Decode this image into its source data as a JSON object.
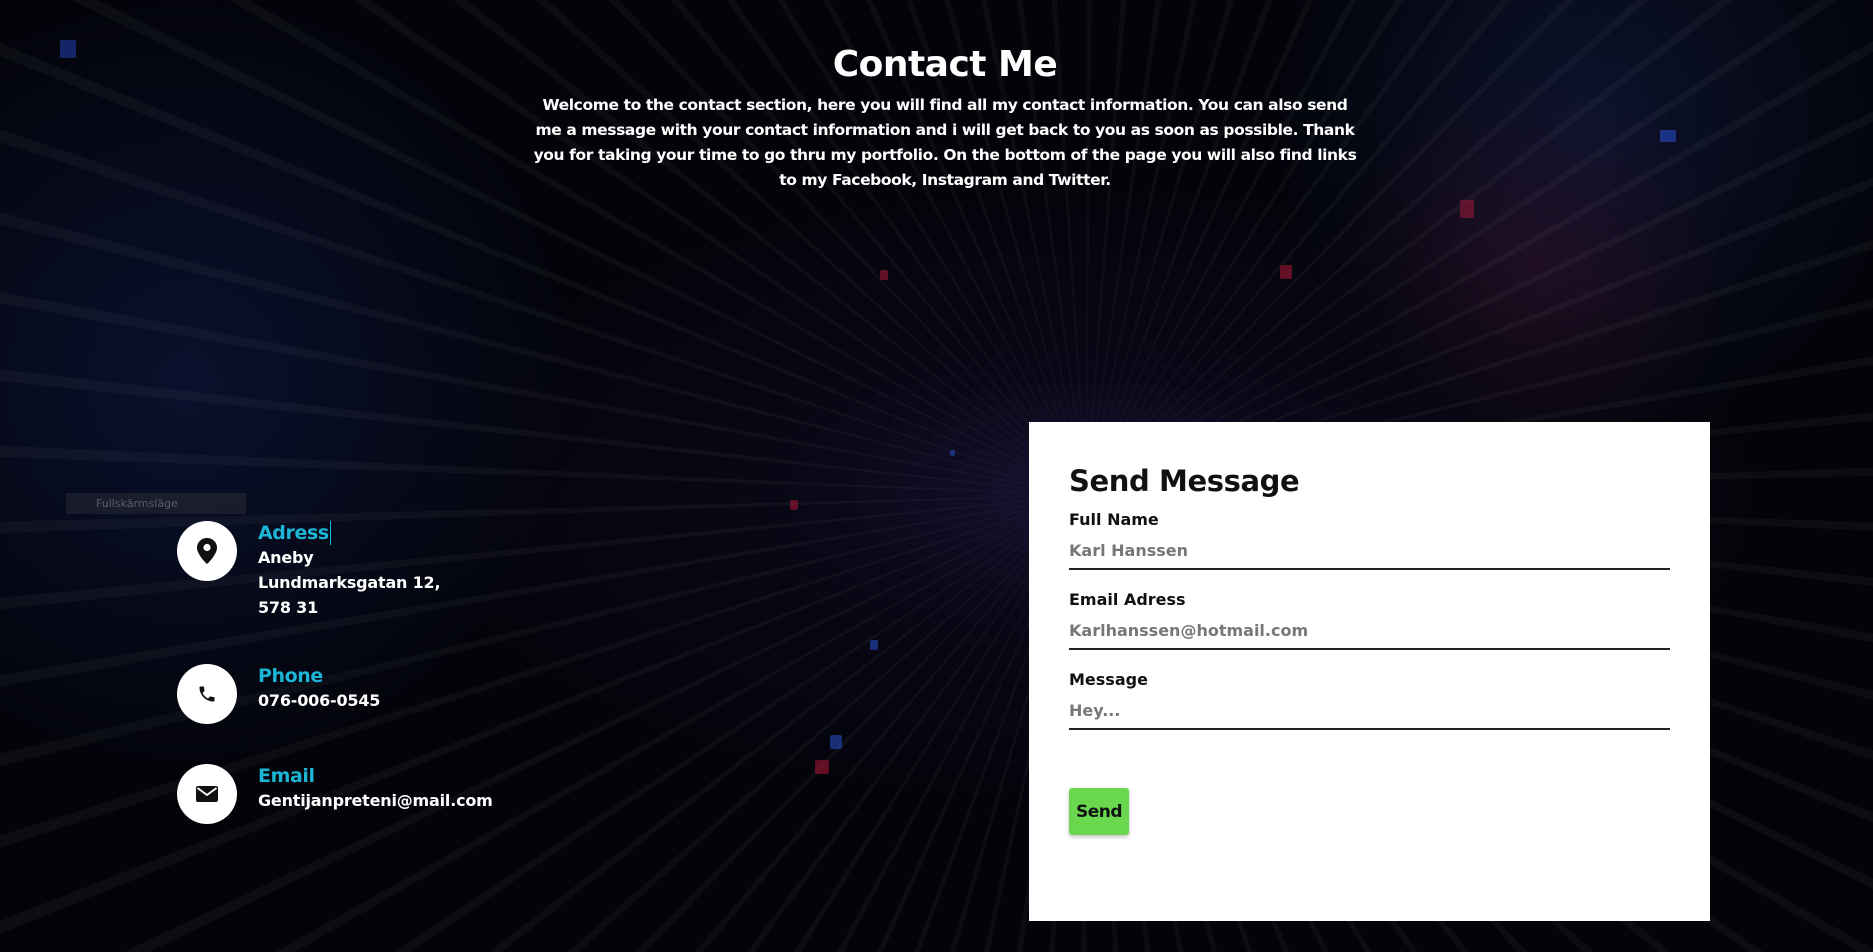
{
  "header": {
    "title": "Contact Me",
    "intro": "Welcome to the contact section, here you will find all my contact information. You can also send me a message with your contact information and i will get back to you as soon as possible. Thank you for taking your time to go thru my portfolio. On the bottom of the page you will also find links to my Facebook, Instagram and Twitter."
  },
  "tooltip": "Fullskärmsläge",
  "contact": {
    "address": {
      "icon": "map-pin-icon",
      "title": "Adress",
      "lines": [
        "Aneby",
        "Lundmarksgatan 12,",
        "578 31"
      ]
    },
    "phone": {
      "icon": "phone-icon",
      "title": "Phone",
      "value": "076-006-0545"
    },
    "email": {
      "icon": "envelope-icon",
      "title": "Email",
      "value": "Gentijanpreteni@mail.com"
    }
  },
  "form": {
    "title": "Send Message",
    "fields": [
      {
        "label": "Full Name",
        "placeholder": "Karl Hanssen"
      },
      {
        "label": "Email Adress",
        "placeholder": "Karlhanssen@hotmail.com"
      },
      {
        "label": "Message",
        "placeholder": "Hey..."
      }
    ],
    "send_label": "Send"
  },
  "colors": {
    "accent": "#1cb5d6",
    "button": "#6ad84f",
    "background": "#03040a"
  }
}
